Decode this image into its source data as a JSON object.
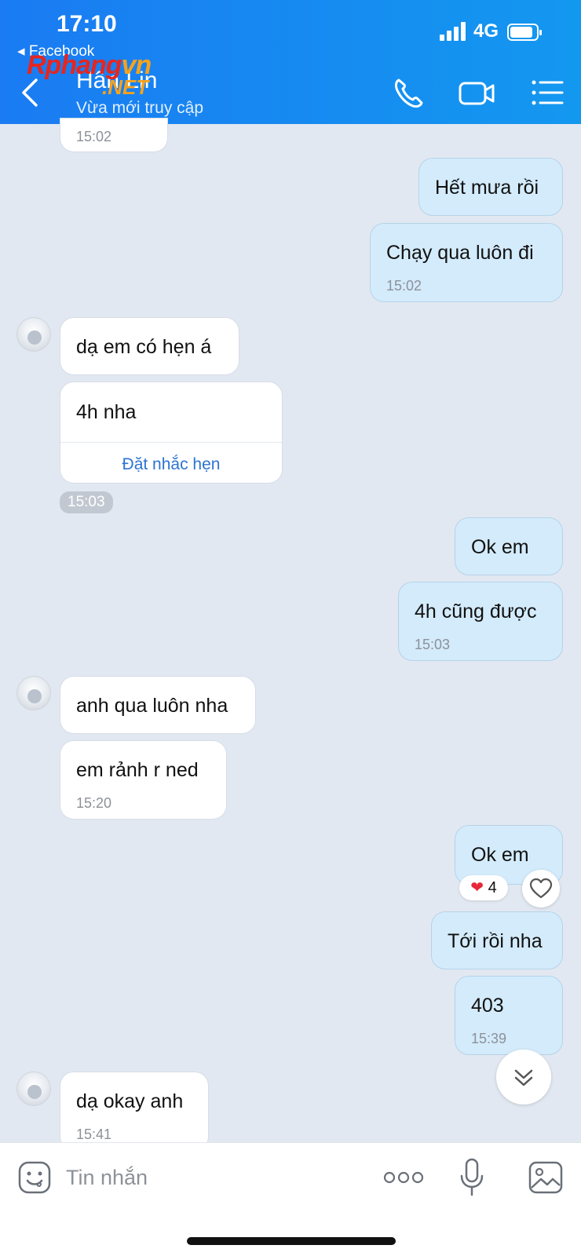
{
  "status_bar": {
    "time": "17:10",
    "back_app": "◂ Facebook",
    "network": "4G",
    "battery_icon": "battery-full-icon"
  },
  "watermark": {
    "main": "Rphang",
    "suffix": "vn",
    "net": ".NET"
  },
  "header": {
    "contact_name": "Hân Lin",
    "contact_status": "Vừa mới truy cập",
    "icons": [
      "back-arrow-icon",
      "phone-icon",
      "video-camera-icon",
      "menu-list-icon"
    ],
    "bg_color": "#1a7bf2"
  },
  "messages": {
    "m0": {
      "time": "15:02"
    },
    "m1": {
      "text": "Hết mưa rồi"
    },
    "m2": {
      "text": "Chạy qua luôn đi",
      "time": "15:02"
    },
    "m3": {
      "text": "dạ em có hẹn á"
    },
    "m4": {
      "text": "4h nha",
      "action": "Đặt nhắc hẹn"
    },
    "m4_time": "15:03",
    "m5": {
      "text": "Ok em"
    },
    "m6": {
      "text": "4h cũng được",
      "time": "15:03"
    },
    "m7": {
      "text": "anh qua luôn nha"
    },
    "m8": {
      "text": "em rảnh r ned",
      "time": "15:20"
    },
    "m9": {
      "text": "Ok em",
      "reaction_count": "4",
      "reaction_icon": "heart-icon"
    },
    "m10": {
      "text": "Tới rồi nha"
    },
    "m11": {
      "text": "403",
      "time": "15:39"
    },
    "m12": {
      "text": "dạ okay anh",
      "time": "15:41"
    }
  },
  "composer": {
    "placeholder": "Tin nhắn",
    "icons": [
      "emoji-icon",
      "more-dots-icon",
      "microphone-icon",
      "gallery-icon"
    ]
  },
  "colors": {
    "outgoing_bubble": "#d3ebfb",
    "incoming_bubble": "#ffffff",
    "chat_background": "#e2e8f1",
    "link": "#2f73d1",
    "heart": "#e8283a"
  }
}
